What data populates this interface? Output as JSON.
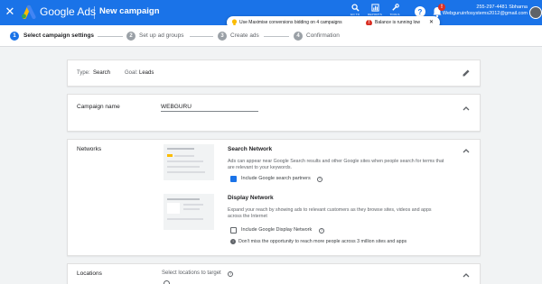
{
  "header": {
    "brand": "Google Ads",
    "page_title": "New campaign",
    "tools": [
      {
        "icon": "search-icon",
        "label": "GO TO"
      },
      {
        "icon": "reports-icon",
        "label": "REPORTS"
      },
      {
        "icon": "tools-icon",
        "label": "TOOLS"
      }
    ],
    "help_icon": "help-icon",
    "notifications_icon": "bell-icon",
    "notifications_badge": "!",
    "account": {
      "phone_name": "255-297-4481 Sbharna",
      "email": "Webguruinfosystems2012@gmail.com"
    },
    "brand_colors": {
      "bar": "#1a73e8",
      "logo_blue": "#4285f4",
      "logo_yellow": "#fbbc04",
      "logo_green": "#34a853"
    }
  },
  "notice": {
    "tip": "Use Maximise conversions bidding on 4 campaigns",
    "warning": "Balance is running low",
    "close": "✕",
    "warning_color": "#d93025"
  },
  "stepper": {
    "steps": [
      {
        "number": "1",
        "label": "Select campaign settings",
        "active": true
      },
      {
        "number": "2",
        "label": "Set up ad groups",
        "active": false
      },
      {
        "number": "3",
        "label": "Create ads",
        "active": false
      },
      {
        "number": "4",
        "label": "Confirmation",
        "active": false
      }
    ],
    "active_color": "#1a73e8",
    "inactive_color": "#9aa0a6"
  },
  "summary_card": {
    "type_label": "Type:",
    "type_value": "Search",
    "goal_label": "Goal:",
    "goal_value": "Leads",
    "edit_icon": "pencil-icon"
  },
  "campaign_name_card": {
    "label": "Campaign name",
    "value": "WEBGURU"
  },
  "networks_card": {
    "label": "Networks",
    "search_network": {
      "title": "Search Network",
      "description": "Ads can appear near Google Search results and other Google sites when people search for terms that are relevant to your keywords.",
      "checkbox_label": "Include Google search partners",
      "checked": true
    },
    "display_network": {
      "title": "Display Network",
      "description": "Expand your reach by showing ads to relevant customers as they browse sites, videos and apps across the Internet",
      "checkbox_label": "Include Google Display Network",
      "checked": false,
      "info": "Don't miss the opportunity to reach more people across 3 million sites and apps"
    }
  },
  "locations_card": {
    "label": "Locations",
    "prompt": "Select locations to target"
  }
}
